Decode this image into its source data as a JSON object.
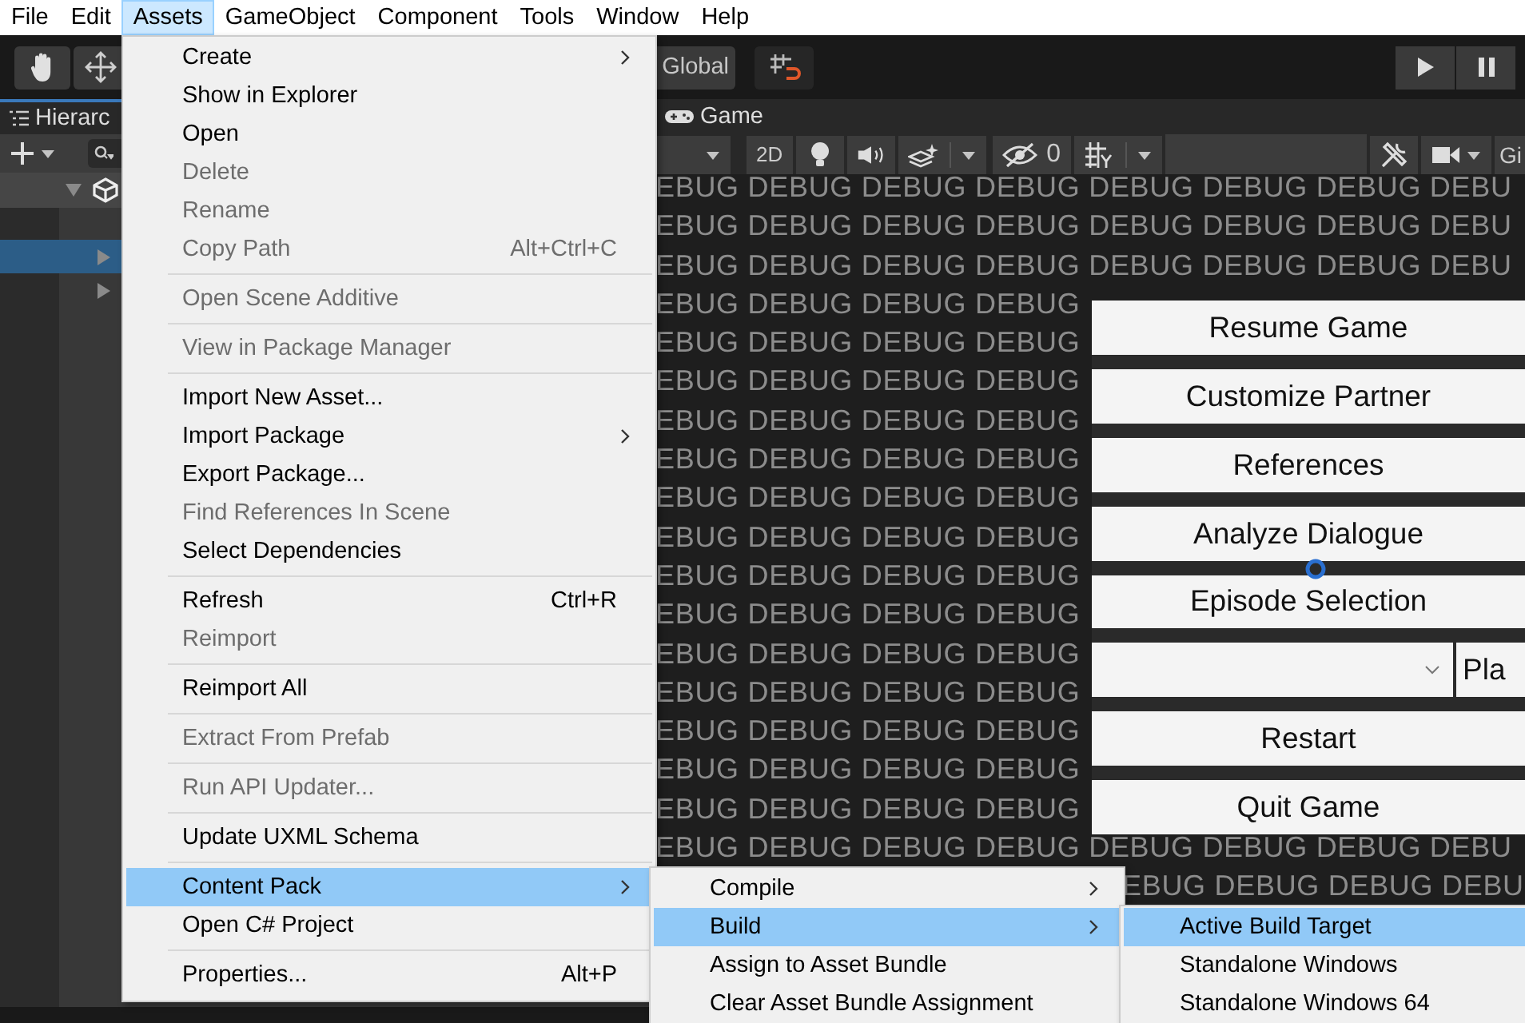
{
  "menu_bar": {
    "items": [
      {
        "label": "File",
        "selected": false
      },
      {
        "label": "Edit",
        "selected": false
      },
      {
        "label": "Assets",
        "selected": true
      },
      {
        "label": "GameObject",
        "selected": false
      },
      {
        "label": "Component",
        "selected": false
      },
      {
        "label": "Tools",
        "selected": false
      },
      {
        "label": "Window",
        "selected": false
      },
      {
        "label": "Help",
        "selected": false
      }
    ]
  },
  "toolbar": {
    "pivot_button": "Global"
  },
  "hierarchy": {
    "tab": "Hierarc",
    "rows": [
      {
        "kind": "scene",
        "expanded": true,
        "selected": false
      },
      {
        "kind": "gap"
      },
      {
        "kind": "object",
        "expanded": false,
        "selected": true
      },
      {
        "kind": "object",
        "expanded": false,
        "selected": false
      }
    ]
  },
  "game_view": {
    "tab": "Game",
    "toolbar": {
      "mode_button": "2D",
      "hidden_count": "0",
      "gizmos_label": "Gi"
    },
    "debug_text": {
      "top_rows": [
        "EBUG DEBUG DEBUG DEBUG DEBUG DEBUG DEBUG DEBU",
        "EBUG DEBUG DEBUG DEBUG DEBUG DEBUG DEBUG DEBU",
        "EBUG DEBUG DEBUG DEBUG DEBUG DEBUG DEBUG DEBU"
      ],
      "side_rows": [
        "EBUG DEBUG DEBUG DEBUG",
        "EBUG DEBUG DEBUG DEBUG",
        "EBUG DEBUG DEBUG DEBUG",
        "EBUG DEBUG DEBUG DEBUG",
        "EBUG DEBUG DEBUG DEBUG",
        "EBUG DEBUG DEBUG DEBUG",
        "EBUG DEBUG DEBUG DEBUG",
        "EBUG DEBUG DEBUG DEBUG",
        "EBUG DEBUG DEBUG DEBUG",
        "EBUG DEBUG DEBUG DEBUG",
        "EBUG DEBUG DEBUG DEBUG",
        "EBUG DEBUG DEBUG DEBUG",
        "EBUG DEBUG DEBUG DEBUG",
        "EBUG DEBUG DEBUG DEBUG"
      ],
      "below_rows": [
        "EBUG DEBUG DEBUG DEBUG DEBUG DEBUG DEBUG DEBU"
      ],
      "corner_rows": [
        "EBUG DEBUG DEBUG DEBU"
      ]
    },
    "buttons": [
      {
        "kind": "button",
        "label": "Resume Game"
      },
      {
        "kind": "button",
        "label": "Customize Partner"
      },
      {
        "kind": "button",
        "label": "References"
      },
      {
        "kind": "button",
        "label": "Analyze Dialogue"
      },
      {
        "kind": "button",
        "label": "Episode Selection"
      },
      {
        "kind": "dropdown",
        "play_label": "Pla"
      },
      {
        "kind": "button",
        "label": "Restart"
      },
      {
        "kind": "button",
        "label": "Quit Game"
      }
    ]
  },
  "assets_menu": {
    "items": [
      {
        "kind": "item",
        "label": "Create",
        "submenu": true,
        "disabled": false,
        "selected": false
      },
      {
        "kind": "item",
        "label": "Show in Explorer",
        "disabled": false,
        "selected": false
      },
      {
        "kind": "item",
        "label": "Open",
        "disabled": false,
        "selected": false
      },
      {
        "kind": "item",
        "label": "Delete",
        "disabled": true,
        "selected": false
      },
      {
        "kind": "item",
        "label": "Rename",
        "disabled": true,
        "selected": false
      },
      {
        "kind": "item",
        "label": "Copy Path",
        "shortcut": "Alt+Ctrl+C",
        "disabled": true,
        "selected": false
      },
      {
        "kind": "separator"
      },
      {
        "kind": "item",
        "label": "Open Scene Additive",
        "disabled": true,
        "selected": false
      },
      {
        "kind": "separator"
      },
      {
        "kind": "item",
        "label": "View in Package Manager",
        "disabled": true,
        "selected": false
      },
      {
        "kind": "separator"
      },
      {
        "kind": "item",
        "label": "Import New Asset...",
        "disabled": false,
        "selected": false
      },
      {
        "kind": "item",
        "label": "Import Package",
        "submenu": true,
        "disabled": false,
        "selected": false
      },
      {
        "kind": "item",
        "label": "Export Package...",
        "disabled": false,
        "selected": false
      },
      {
        "kind": "item",
        "label": "Find References In Scene",
        "disabled": true,
        "selected": false
      },
      {
        "kind": "item",
        "label": "Select Dependencies",
        "disabled": false,
        "selected": false
      },
      {
        "kind": "separator"
      },
      {
        "kind": "item",
        "label": "Refresh",
        "shortcut": "Ctrl+R",
        "disabled": false,
        "selected": false
      },
      {
        "kind": "item",
        "label": "Reimport",
        "disabled": true,
        "selected": false
      },
      {
        "kind": "separator"
      },
      {
        "kind": "item",
        "label": "Reimport All",
        "disabled": false,
        "selected": false
      },
      {
        "kind": "separator"
      },
      {
        "kind": "item",
        "label": "Extract From Prefab",
        "disabled": true,
        "selected": false
      },
      {
        "kind": "separator"
      },
      {
        "kind": "item",
        "label": "Run API Updater...",
        "disabled": true,
        "selected": false
      },
      {
        "kind": "separator"
      },
      {
        "kind": "item",
        "label": "Update UXML Schema",
        "disabled": false,
        "selected": false
      },
      {
        "kind": "separator"
      },
      {
        "kind": "item",
        "label": "Content Pack",
        "submenu": true,
        "disabled": false,
        "selected": true
      },
      {
        "kind": "item",
        "label": "Open C# Project",
        "disabled": false,
        "selected": false
      },
      {
        "kind": "separator"
      },
      {
        "kind": "item",
        "label": "Properties...",
        "shortcut": "Alt+P",
        "disabled": false,
        "selected": false
      }
    ]
  },
  "content_pack_menu": {
    "items": [
      {
        "kind": "item",
        "label": "Compile",
        "submenu": true,
        "disabled": false,
        "selected": false
      },
      {
        "kind": "item",
        "label": "Build",
        "submenu": true,
        "disabled": false,
        "selected": true
      },
      {
        "kind": "item",
        "label": "Assign to Asset Bundle",
        "disabled": false,
        "selected": false
      },
      {
        "kind": "item",
        "label": "Clear Asset Bundle Assignment",
        "disabled": false,
        "selected": false
      }
    ]
  },
  "build_menu": {
    "items": [
      {
        "kind": "item",
        "label": "Active Build Target",
        "disabled": false,
        "selected": true
      },
      {
        "kind": "item",
        "label": "Standalone Windows",
        "disabled": false,
        "selected": false
      },
      {
        "kind": "item",
        "label": "Standalone Windows 64",
        "disabled": false,
        "selected": false
      }
    ]
  }
}
